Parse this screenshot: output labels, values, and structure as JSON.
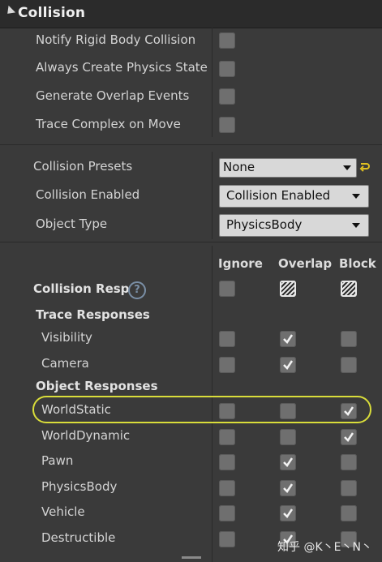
{
  "header": {
    "title": "Collision"
  },
  "top_rows": [
    {
      "label": "Notify Rigid Body Collision"
    },
    {
      "label": "Always Create Physics State"
    },
    {
      "label": "Generate Overlap Events"
    },
    {
      "label": "Trace Complex on Move"
    }
  ],
  "preset_rows": {
    "presets": {
      "label": "Collision Presets",
      "value": "None"
    },
    "enabled": {
      "label": "Collision Enabled",
      "value": "Collision Enabled"
    },
    "object_type": {
      "label": "Object Type",
      "value": "PhysicsBody"
    }
  },
  "response_columns": [
    "Ignore",
    "Overlap",
    "Block"
  ],
  "collision_responses_label": "Collision Resp",
  "help_glyph": "?",
  "trace_section_label": "Trace Responses",
  "object_section_label": "Object Responses",
  "trace_rows": [
    {
      "label": "Visibility",
      "ignore": false,
      "overlap": true,
      "block": false
    },
    {
      "label": "Camera",
      "ignore": false,
      "overlap": true,
      "block": false
    }
  ],
  "object_rows": [
    {
      "label": "WorldStatic",
      "ignore": false,
      "overlap": false,
      "block": true,
      "highlighted": true
    },
    {
      "label": "WorldDynamic",
      "ignore": false,
      "overlap": false,
      "block": true
    },
    {
      "label": "Pawn",
      "ignore": false,
      "overlap": true,
      "block": false
    },
    {
      "label": "PhysicsBody",
      "ignore": false,
      "overlap": true,
      "block": false
    },
    {
      "label": "Vehicle",
      "ignore": false,
      "overlap": true,
      "block": false
    },
    {
      "label": "Destructible",
      "ignore": false,
      "overlap": true,
      "block": false
    }
  ],
  "watermark": "知乎 @K丶E丶N丶",
  "colors": {
    "highlight": "#d9dd3a",
    "panel": "#3a3a3a",
    "header": "#2b2b2b"
  }
}
